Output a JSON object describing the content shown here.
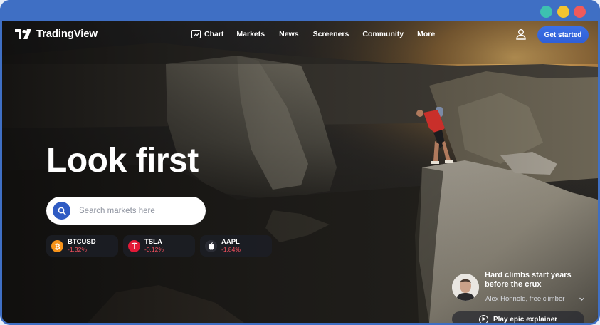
{
  "window": {
    "controls": [
      {
        "name": "minimize",
        "color": "#3dc1b0"
      },
      {
        "name": "maximize",
        "color": "#f4c430"
      },
      {
        "name": "close",
        "color": "#f05a5a"
      }
    ]
  },
  "brand": {
    "name": "TradingView"
  },
  "nav": {
    "items": [
      {
        "label": "Chart",
        "icon": "chart-icon"
      },
      {
        "label": "Markets"
      },
      {
        "label": "News"
      },
      {
        "label": "Screeners"
      },
      {
        "label": "Community"
      },
      {
        "label": "More"
      }
    ],
    "cta_label": "Get started",
    "user_icon": "user-icon"
  },
  "hero": {
    "headline": "Look first",
    "search_placeholder": "Search markets here"
  },
  "tickers": [
    {
      "symbol": "BTCUSD",
      "change": "-1.32%",
      "icon": "bitcoin-icon",
      "icon_color": "#f7931a"
    },
    {
      "symbol": "TSLA",
      "change": "-0.12%",
      "icon": "tesla-icon",
      "icon_color": "#e31937"
    },
    {
      "symbol": "AAPL",
      "change": "-1.84%",
      "icon": "apple-icon",
      "icon_color": "#2a2c34"
    }
  ],
  "quote": {
    "title": "Hard climbs start years before the crux",
    "author": "Alex Honnold, free climber",
    "play_label": "Play epic explainer"
  },
  "colors": {
    "frame": "#3f6fc4",
    "accent": "#2962ff",
    "negative": "#f7525f"
  }
}
